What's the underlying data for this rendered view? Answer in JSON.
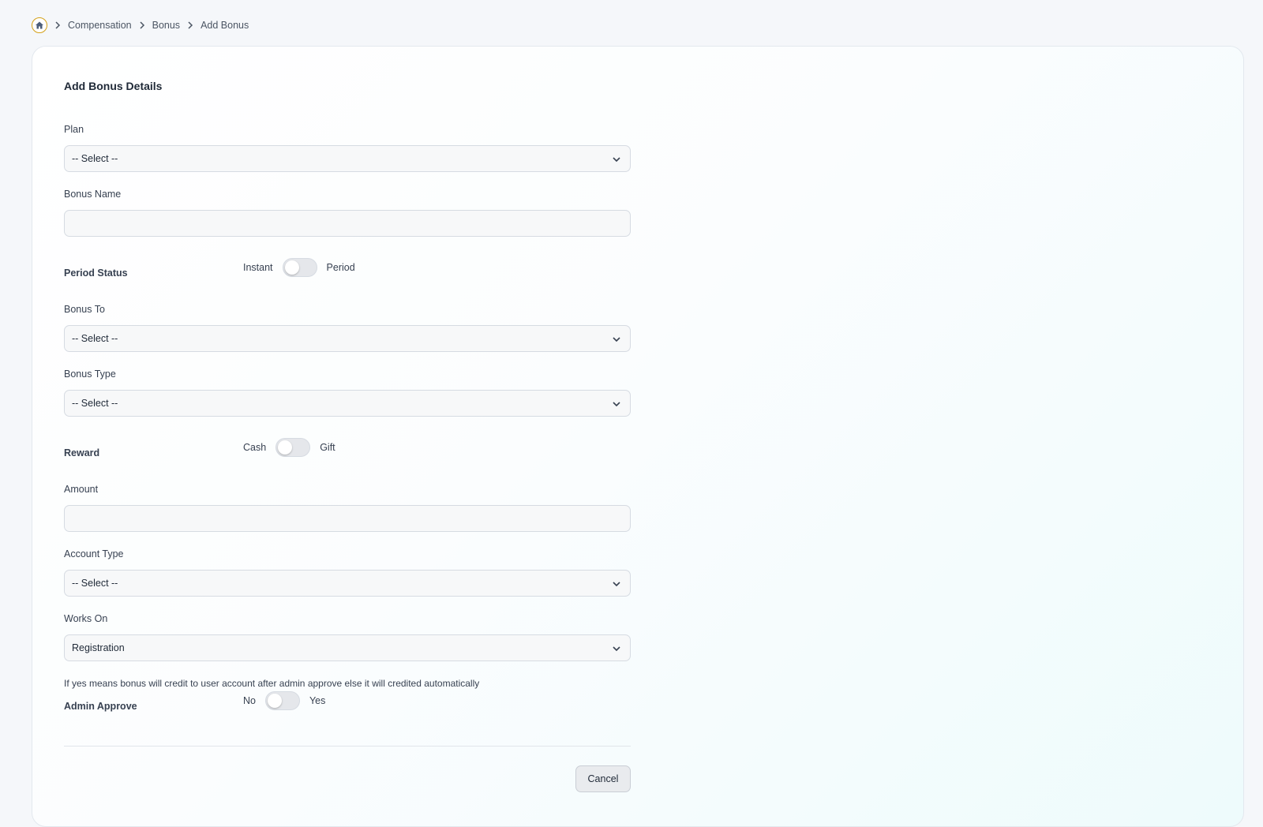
{
  "breadcrumb": {
    "items": [
      "Compensation",
      "Bonus",
      "Add Bonus"
    ]
  },
  "form": {
    "title": "Add Bonus Details",
    "plan": {
      "label": "Plan",
      "value": "-- Select --"
    },
    "bonus_name": {
      "label": "Bonus Name",
      "value": ""
    },
    "period_status": {
      "label": "Period Status",
      "off": "Instant",
      "on": "Period",
      "checked": false
    },
    "bonus_to": {
      "label": "Bonus To",
      "value": "-- Select --"
    },
    "bonus_type": {
      "label": "Bonus Type",
      "value": "-- Select --"
    },
    "reward": {
      "label": "Reward",
      "off": "Cash",
      "on": "Gift",
      "checked": false
    },
    "amount": {
      "label": "Amount",
      "value": ""
    },
    "account_type": {
      "label": "Account Type",
      "value": "-- Select --"
    },
    "works_on": {
      "label": "Works On",
      "value": "Registration"
    },
    "admin_note": "If yes means bonus will credit to user account after admin approve else it will credited automatically",
    "admin_approve": {
      "label": "Admin Approve",
      "off": "No",
      "on": "Yes",
      "checked": false
    },
    "cancel_label": "Cancel"
  },
  "colors": {
    "accent_home_ring": "#d4a017",
    "card_gradient_end": "#eefbfc"
  }
}
